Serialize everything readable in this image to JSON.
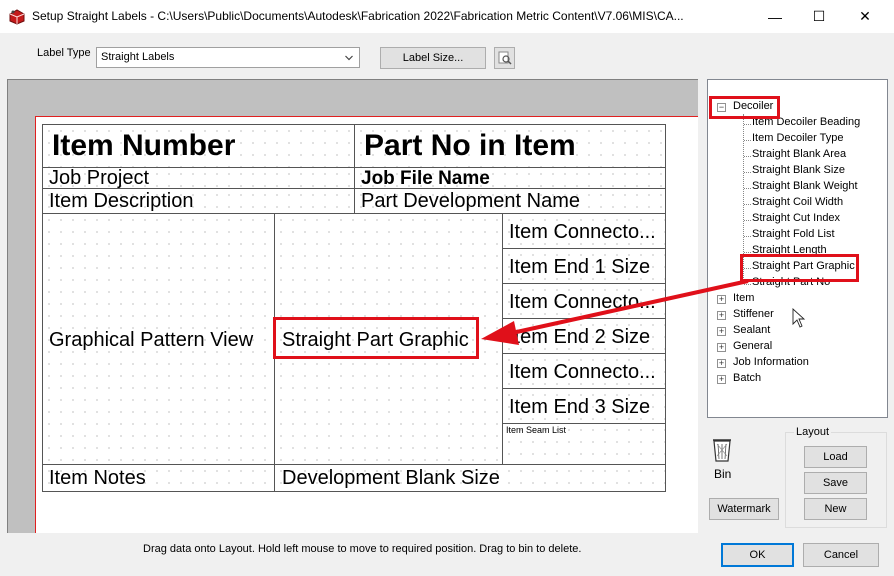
{
  "window": {
    "title": "Setup Straight Labels - C:\\Users\\Public\\Documents\\Autodesk\\Fabrication 2022\\Fabrication Metric Content\\V7.06\\MIS\\CA...",
    "minimize": "—",
    "maximize": "☐",
    "close": "✕"
  },
  "toolbar": {
    "label_type_caption": "Label Type",
    "label_type_value": "Straight Labels",
    "label_size_button": "Label Size..."
  },
  "layout_cells": {
    "item_number": "Item Number",
    "part_no_in_item": "Part No in Item",
    "job_project": "Job Project",
    "job_file_name": "Job File Name",
    "item_description": "Item Description",
    "part_development_name": "Part Development Name",
    "graphical_pattern_view": "Graphical Pattern View",
    "straight_part_graphic": "Straight Part Graphic",
    "item_connector_1": "Item Connecto...",
    "item_end_1_size": "Item End 1 Size",
    "item_connector_2": "Item Connecto...",
    "item_end_2_size": "Item End 2 Size",
    "item_connector_3": "Item Connecto...",
    "item_end_3_size": "Item End 3 Size",
    "item_seam_list": "Item Seam List",
    "item_notes": "Item Notes",
    "development_blank_size": "Development Blank Size"
  },
  "tree": {
    "root_expanded": "Decoiler",
    "children": [
      "Item Decoiler Beading",
      "Item Decoiler Type",
      "Straight Blank Area",
      "Straight Blank Size",
      "Straight Blank Weight",
      "Straight Coil Width",
      "Straight Cut Index",
      "Straight Fold List",
      "Straight Length",
      "Straight Part Graphic",
      "Straight Part No"
    ],
    "collapsed": [
      "Item",
      "Stiffener",
      "Sealant",
      "General",
      "Job Information",
      "Batch"
    ]
  },
  "side": {
    "bin_label": "Bin",
    "watermark_button": "Watermark",
    "layout_group_title": "Layout",
    "load_button": "Load",
    "save_button": "Save",
    "new_button": "New"
  },
  "footer": {
    "status": "Drag data onto Layout. Hold left mouse to move to required position. Drag to bin to delete.",
    "ok_button": "OK",
    "cancel_button": "Cancel"
  },
  "annotation_color": "#e0101a"
}
